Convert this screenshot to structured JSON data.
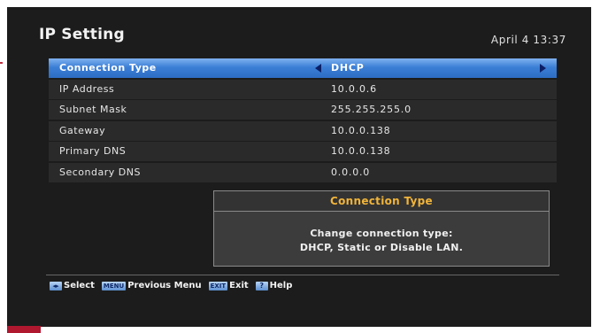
{
  "header": {
    "title": "IP Setting",
    "datetime": "April 4 13:37"
  },
  "settings": [
    {
      "label": "Connection Type",
      "value": "DHCP",
      "selected": true
    },
    {
      "label": "IP Address",
      "value": "10.0.0.6"
    },
    {
      "label": "Subnet Mask",
      "value": "255.255.255.0"
    },
    {
      "label": "Gateway",
      "value": "10.0.0.138"
    },
    {
      "label": "Primary DNS",
      "value": "10.0.0.138"
    },
    {
      "label": "Secondary DNS",
      "value": "0.0.0.0"
    }
  ],
  "info": {
    "title": "Connection Type",
    "line1": "Change connection type:",
    "line2": "DHCP, Static or Disable LAN."
  },
  "footer": {
    "nav_key": "◂▸",
    "select_label": "Select",
    "menu_key": "MENU",
    "previous_menu_label": "Previous Menu",
    "exit_key": "EXIT",
    "exit_label": "Exit",
    "help_key": "?",
    "help_label": "Help"
  },
  "colors": {
    "background": "#1c1c1c",
    "selected_row": "#3b7fd6",
    "info_title": "#f0b43a"
  }
}
